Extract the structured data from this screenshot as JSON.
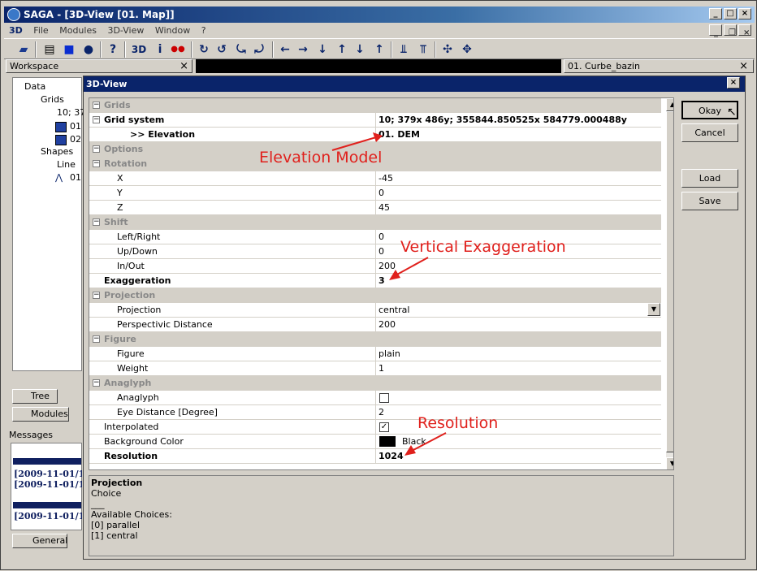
{
  "window": {
    "title": "SAGA - [3D-View [01. Map]]",
    "minimize": "_",
    "maximize": "□",
    "close": "×"
  },
  "menu": [
    "File",
    "Modules",
    "3D-View",
    "Window",
    "?"
  ],
  "menu_icon": "3D",
  "toolbar_icons": [
    "open-icon",
    "map-icon",
    "grid-icon",
    "info-icon",
    "help-icon",
    "3d-icon",
    "i-icon",
    "color-icon",
    "rotate-left-icon",
    "rotate-right-icon",
    "tilt-left-icon",
    "tilt-right-icon",
    "arrow-left-icon",
    "arrow-right-icon",
    "arrow-down-icon",
    "arrow-up-icon",
    "arrow-down2-icon",
    "arrow-up2-icon",
    "exag-down-icon",
    "exag-up-icon",
    "move-in-icon",
    "move-out-icon"
  ],
  "workspace": {
    "title": "Workspace",
    "close": "×"
  },
  "doc_tab": {
    "title": "01. Curbe_bazin",
    "close": "×"
  },
  "tree": {
    "items": [
      "Data",
      "Grids",
      "10; 37",
      "01",
      "02",
      "Shapes",
      "Line",
      "01"
    ]
  },
  "left_tabs": {
    "tree": "Tree",
    "modules": "Modules",
    "general": "General"
  },
  "messages": {
    "title": "Messages",
    "lines": [
      "[2009-11-01/1",
      "[2009-11-01/1",
      "[2009-11-01/1"
    ]
  },
  "dialog": {
    "title": "3D-View",
    "close": "×",
    "buttons": {
      "okay": "Okay",
      "cancel": "Cancel",
      "load": "Load",
      "save": "Save"
    },
    "rows": [
      {
        "label": "Grids",
        "value": "",
        "kind": "cat",
        "indent": 1,
        "expander": "⊟"
      },
      {
        "label": "Grid system",
        "value": "10; 379x 486y; 355844.850525x 584779.000488y",
        "kind": "bold",
        "indent": 1,
        "expander": "⊟"
      },
      {
        "label": ">> Elevation",
        "value": "01. DEM",
        "kind": "bold",
        "indent": 3
      },
      {
        "label": "Options",
        "value": "",
        "kind": "cat",
        "indent": 0,
        "expander": "⊟"
      },
      {
        "label": "Rotation",
        "value": "",
        "kind": "cat",
        "indent": 1,
        "expander": "⊟"
      },
      {
        "label": "X",
        "value": "-45",
        "kind": "",
        "indent": 2
      },
      {
        "label": "Y",
        "value": "0",
        "kind": "",
        "indent": 2
      },
      {
        "label": "Z",
        "value": "45",
        "kind": "",
        "indent": 2
      },
      {
        "label": "Shift",
        "value": "",
        "kind": "cat",
        "indent": 1,
        "expander": "⊟"
      },
      {
        "label": "Left/Right",
        "value": "0",
        "kind": "",
        "indent": 2
      },
      {
        "label": "Up/Down",
        "value": "0",
        "kind": "",
        "indent": 2
      },
      {
        "label": "In/Out",
        "value": "200",
        "kind": "",
        "indent": 2
      },
      {
        "label": "Exaggeration",
        "value": "3",
        "kind": "bold",
        "indent": 1
      },
      {
        "label": "Projection",
        "value": "",
        "kind": "cat",
        "indent": 1,
        "expander": "⊟"
      },
      {
        "label": "Projection",
        "value": "central",
        "kind": "select",
        "indent": 2
      },
      {
        "label": "Perspectivic Distance",
        "value": "200",
        "kind": "",
        "indent": 2
      },
      {
        "label": "Figure",
        "value": "",
        "kind": "cat",
        "indent": 1,
        "expander": "⊟"
      },
      {
        "label": "Figure",
        "value": "plain",
        "kind": "",
        "indent": 2
      },
      {
        "label": "Weight",
        "value": "1",
        "kind": "",
        "indent": 2
      },
      {
        "label": "Anaglyph",
        "value": "",
        "kind": "cat",
        "indent": 1,
        "expander": "⊟"
      },
      {
        "label": "Anaglyph",
        "value": "",
        "kind": "checkbox",
        "checked": false,
        "indent": 2
      },
      {
        "label": "Eye Distance [Degree]",
        "value": "2",
        "kind": "",
        "indent": 2
      },
      {
        "label": "Interpolated",
        "value": "",
        "kind": "checkbox",
        "checked": true,
        "indent": 1
      },
      {
        "label": "Background Color",
        "value": "Black",
        "kind": "color",
        "indent": 1
      },
      {
        "label": "Resolution",
        "value": "1024",
        "kind": "bold",
        "indent": 1
      }
    ],
    "description": {
      "title": "Projection",
      "type": "Choice",
      "rule": "___",
      "choices_label": "Available Choices:",
      "choices": [
        "[0] parallel",
        "[1] central"
      ]
    }
  },
  "annotations": {
    "elevation": "Elevation Model",
    "exaggeration": "Vertical Exaggeration",
    "resolution": "Resolution"
  },
  "colors": {
    "title_bar": "#0a246a",
    "annotation": "#e0201c",
    "background_color_swatch": "#000000"
  }
}
